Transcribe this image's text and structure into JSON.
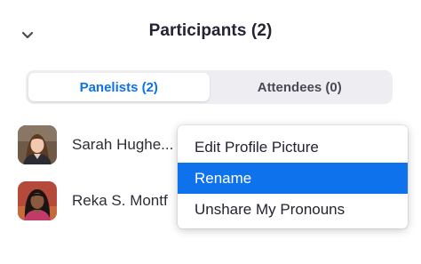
{
  "panel": {
    "title": "Participants (2)",
    "collapse_icon": "chevron-down-icon"
  },
  "tabs": [
    {
      "label": "Panelists (2)",
      "active": true
    },
    {
      "label": "Attendees (0)",
      "active": false
    }
  ],
  "participants": [
    {
      "name": "Sarah Hughe...",
      "avatar": "avatar-photo"
    },
    {
      "name": "Reka S. Montf",
      "avatar": "avatar-photo"
    }
  ],
  "context_menu": {
    "items": [
      {
        "label": "Edit Profile Picture",
        "highlighted": false
      },
      {
        "label": "Rename",
        "highlighted": true
      },
      {
        "label": "Unshare My Pronouns",
        "highlighted": false
      }
    ]
  },
  "colors": {
    "accent": "#0e72ed",
    "tab_track": "#eeeef2",
    "text": "#232333"
  }
}
